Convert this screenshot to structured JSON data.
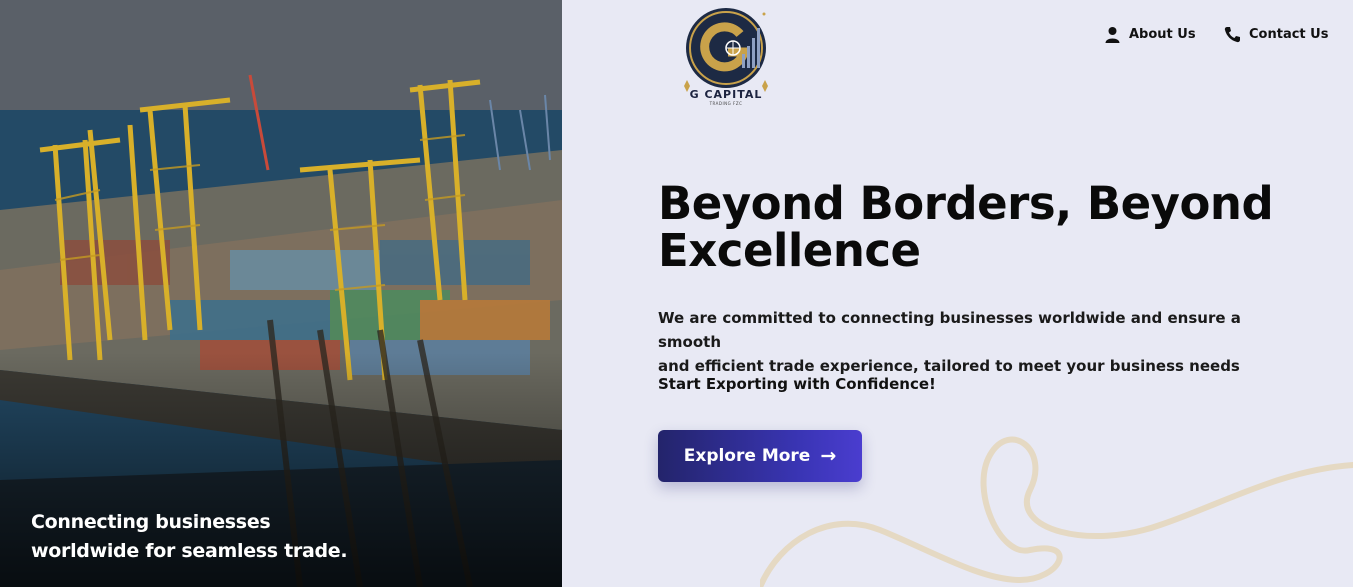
{
  "hero": {
    "caption_line1": "Connecting businesses",
    "caption_line2": "worldwide for seamless trade."
  },
  "brand": {
    "name": "G CAPITAL",
    "subtitle": "TRADING FZC",
    "logo_colors": {
      "navy": "#1d2a44",
      "gold": "#c9a24a"
    }
  },
  "nav": {
    "about": {
      "label": "About Us",
      "icon": "user-icon"
    },
    "contact": {
      "label": "Contact Us",
      "icon": "phone-icon"
    }
  },
  "main": {
    "headline_line1": "Beyond Borders, Beyond",
    "headline_line2": "Excellence",
    "lead_line1": "We are committed to connecting businesses worldwide and ensure a smooth",
    "lead_line2": "and efficient trade experience, tailored to meet your business needs",
    "tagline": "Start Exporting with Confidence!",
    "cta_label": "Explore More",
    "cta_icon": "arrow-right-icon"
  },
  "colors": {
    "background": "#e8e9f4",
    "cta_start": "#23246b",
    "cta_end": "#4a3dcf",
    "swirl": "#e5d9c3"
  }
}
